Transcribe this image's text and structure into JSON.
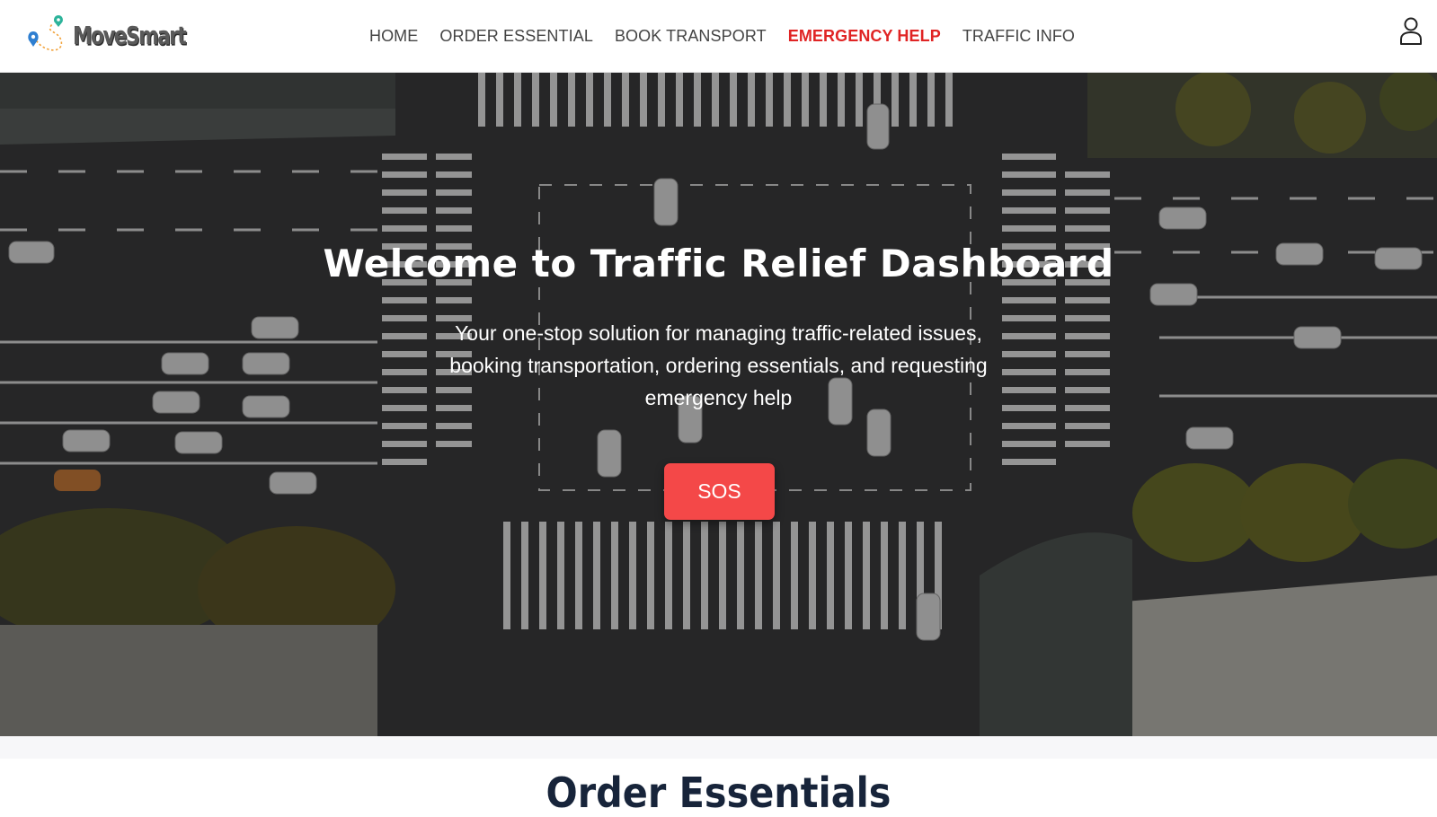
{
  "brand": {
    "name": "MoveSmart"
  },
  "nav": {
    "items": [
      {
        "label": "HOME",
        "active": false
      },
      {
        "label": "ORDER ESSENTIAL",
        "active": false
      },
      {
        "label": "BOOK TRANSPORT",
        "active": false
      },
      {
        "label": "EMERGENCY HELP",
        "active": true
      },
      {
        "label": "TRAFFIC INFO",
        "active": false
      }
    ],
    "user_icon": "user-icon"
  },
  "hero": {
    "title": "Welcome to Traffic Relief Dashboard",
    "subtitle": "Your one-stop solution for managing traffic-related issues, booking transportation, ordering essentials, and requesting emergency help",
    "sos_label": "SOS"
  },
  "sections": {
    "order_essentials_title": "Order Essentials"
  },
  "colors": {
    "accent": "#e02424",
    "sos_button": "#f44848",
    "nav_text": "#444444",
    "section_title": "#17243a"
  }
}
